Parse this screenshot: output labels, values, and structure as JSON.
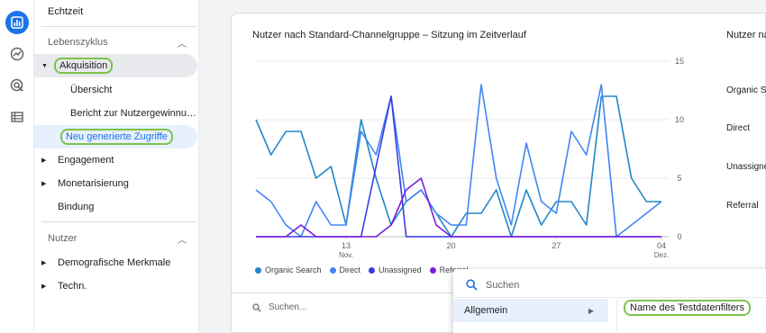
{
  "nav": {
    "top_item": "Echtzeit",
    "section1": "Lebenszyklus",
    "akquisition": "Akquisition",
    "uebersicht": "Übersicht",
    "nutzergewinnung": "Bericht zur Nutzergewinnu…",
    "neu_zugriffe": "Neu generierte Zugriffe",
    "engagement": "Engagement",
    "monetarisierung": "Monetarisierung",
    "bindung": "Bindung",
    "section2": "Nutzer",
    "demografisch": "Demografische Merkmale",
    "techn": "Techn."
  },
  "main": {
    "chart_title": "Nutzer nach Standard-Channelgruppe – Sitzung im Zeitverlauf",
    "side_title": "Nutzer na",
    "side_labels": [
      "Organic Sear",
      "Direct",
      "Unassigne",
      "Referral"
    ],
    "table_search_placeholder": "Suchen..."
  },
  "menu": {
    "search_placeholder": "Suchen",
    "item": "Allgemein",
    "submenu_item": "Name des Testdatenfilters"
  },
  "colors": {
    "accent": "#1a73e8",
    "highlight": "#7cc34b",
    "organic": "#1e88c7",
    "direct": "#4285f4",
    "unassigned": "#3c3ce8",
    "referral": "#7b1fdb"
  },
  "chart_data": {
    "type": "line",
    "ylim": [
      0,
      15
    ],
    "y_ticks": [
      0,
      5,
      10,
      15
    ],
    "x_tick_labels": [
      {
        "index": 6,
        "label": "13",
        "sub": "Nov."
      },
      {
        "index": 13,
        "label": "20",
        "sub": ""
      },
      {
        "index": 20,
        "label": "27",
        "sub": ""
      },
      {
        "index": 27,
        "label": "04",
        "sub": "Dez."
      }
    ],
    "legend": [
      "Organic Search",
      "Direct",
      "Unassigned",
      "Referral"
    ],
    "series": [
      {
        "name": "Organic Search",
        "color": "#1e88c7",
        "values": [
          10,
          7,
          9,
          9,
          5,
          6,
          1,
          10,
          5,
          1,
          3,
          4,
          2,
          0,
          2,
          2,
          4,
          0,
          4,
          1,
          3,
          3,
          1,
          12,
          12,
          5,
          3,
          3
        ]
      },
      {
        "name": "Direct",
        "color": "#4285f4",
        "values": [
          4,
          3,
          1,
          0,
          3,
          1,
          1,
          9,
          7,
          12,
          3,
          4,
          2,
          1,
          1,
          13,
          5,
          1,
          8,
          3,
          2,
          9,
          7,
          13,
          0,
          1,
          2,
          3
        ]
      },
      {
        "name": "Unassigned",
        "color": "#3c3ce8",
        "values": [
          0,
          0,
          0,
          0,
          0,
          0,
          0,
          0,
          6,
          12,
          0,
          0,
          0,
          0,
          0,
          0,
          0,
          0,
          0,
          0,
          0,
          0,
          0,
          0,
          0,
          0,
          0,
          0
        ]
      },
      {
        "name": "Referral",
        "color": "#7b1fdb",
        "values": [
          0,
          0,
          0,
          1,
          0,
          0,
          0,
          0,
          0,
          1,
          4,
          5,
          1,
          0,
          0,
          0,
          0,
          0,
          0,
          0,
          0,
          0,
          0,
          0,
          0,
          0,
          0,
          0
        ]
      }
    ]
  }
}
